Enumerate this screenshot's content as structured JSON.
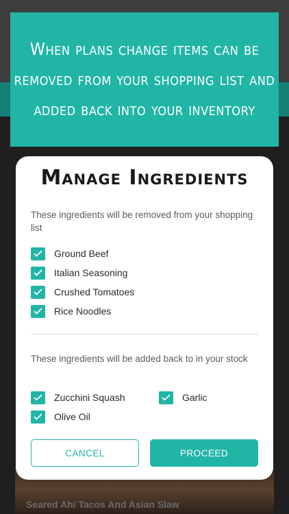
{
  "banner": {
    "text": "When plans change items can be removed from your shopping list and added back into your inventory"
  },
  "background": {
    "recipe_card_title": "Seared Ahi Tacos And Asian Slaw"
  },
  "dialog": {
    "title": "Manage Ingredients",
    "remove_section": {
      "description": "These ingredients will be removed from your shopping list",
      "items": [
        {
          "label": "Ground Beef",
          "checked": true
        },
        {
          "label": "Italian Seasoning",
          "checked": true
        },
        {
          "label": "Crushed Tomatoes",
          "checked": true
        },
        {
          "label": "Rice Noodles",
          "checked": true
        }
      ]
    },
    "add_section": {
      "description": "These ingredients will be added back to in your stock",
      "items": [
        {
          "label": "Zucchini Squash",
          "checked": true
        },
        {
          "label": "Garlic",
          "checked": true
        },
        {
          "label": "Olive Oil",
          "checked": true
        }
      ]
    },
    "cancel_label": "CANCEL",
    "proceed_label": "PROCEED"
  },
  "colors": {
    "accent": "#21b5a6",
    "dim_teal": "#157f78"
  },
  "icons": {
    "checkbox": "checkmark-icon"
  }
}
